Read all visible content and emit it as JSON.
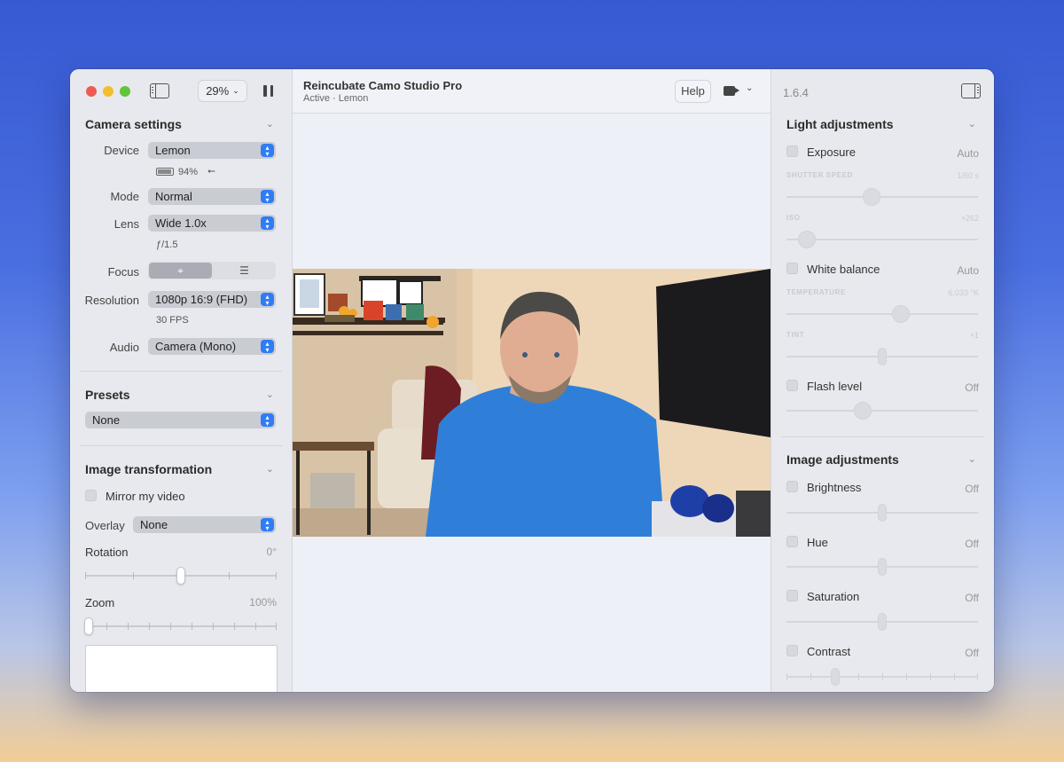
{
  "left": {
    "zoom": "29%",
    "camera_settings": {
      "title": "Camera settings",
      "device_label": "Device",
      "device_value": "Lemon",
      "battery": "94%",
      "mode_label": "Mode",
      "mode_value": "Normal",
      "lens_label": "Lens",
      "lens_value": "Wide 1.0x",
      "aperture": "ƒ/1.5",
      "focus_label": "Focus",
      "resolution_label": "Resolution",
      "resolution_value": "1080p 16:9 (FHD)",
      "fps": "30 FPS",
      "audio_label": "Audio",
      "audio_value": "Camera (Mono)"
    },
    "presets": {
      "title": "Presets",
      "value": "None"
    },
    "image_transformation": {
      "title": "Image transformation",
      "mirror_label": "Mirror my video",
      "overlay_label": "Overlay",
      "overlay_value": "None",
      "rotation_label": "Rotation",
      "rotation_value": "0°",
      "zoom_label": "Zoom",
      "zoom_value": "100%"
    }
  },
  "center": {
    "title": "Reincubate Camo Studio Pro",
    "subtitle": "Active · Lemon",
    "help": "Help"
  },
  "right": {
    "version": "1.6.4",
    "light": {
      "title": "Light adjustments",
      "exposure": "Exposure",
      "exposure_value": "Auto",
      "shutter_label": "SHUTTER SPEED",
      "shutter_value": "1/60 s",
      "iso_label": "ISO",
      "iso_value": "+262",
      "white_balance": "White balance",
      "white_balance_value": "Auto",
      "temperature_label": "TEMPERATURE",
      "temperature_value": "6,033 °K",
      "tint_label": "TINT",
      "tint_value": "+1",
      "flash": "Flash level",
      "flash_value": "Off"
    },
    "image": {
      "title": "Image adjustments",
      "brightness": "Brightness",
      "brightness_value": "Off",
      "hue": "Hue",
      "hue_value": "Off",
      "saturation": "Saturation",
      "saturation_value": "Off",
      "contrast": "Contrast",
      "contrast_value": "Off"
    }
  },
  "colors": {
    "accent": "#2f7cf6",
    "background_top": "#3759d3",
    "background_bottom": "#f2cd95"
  }
}
